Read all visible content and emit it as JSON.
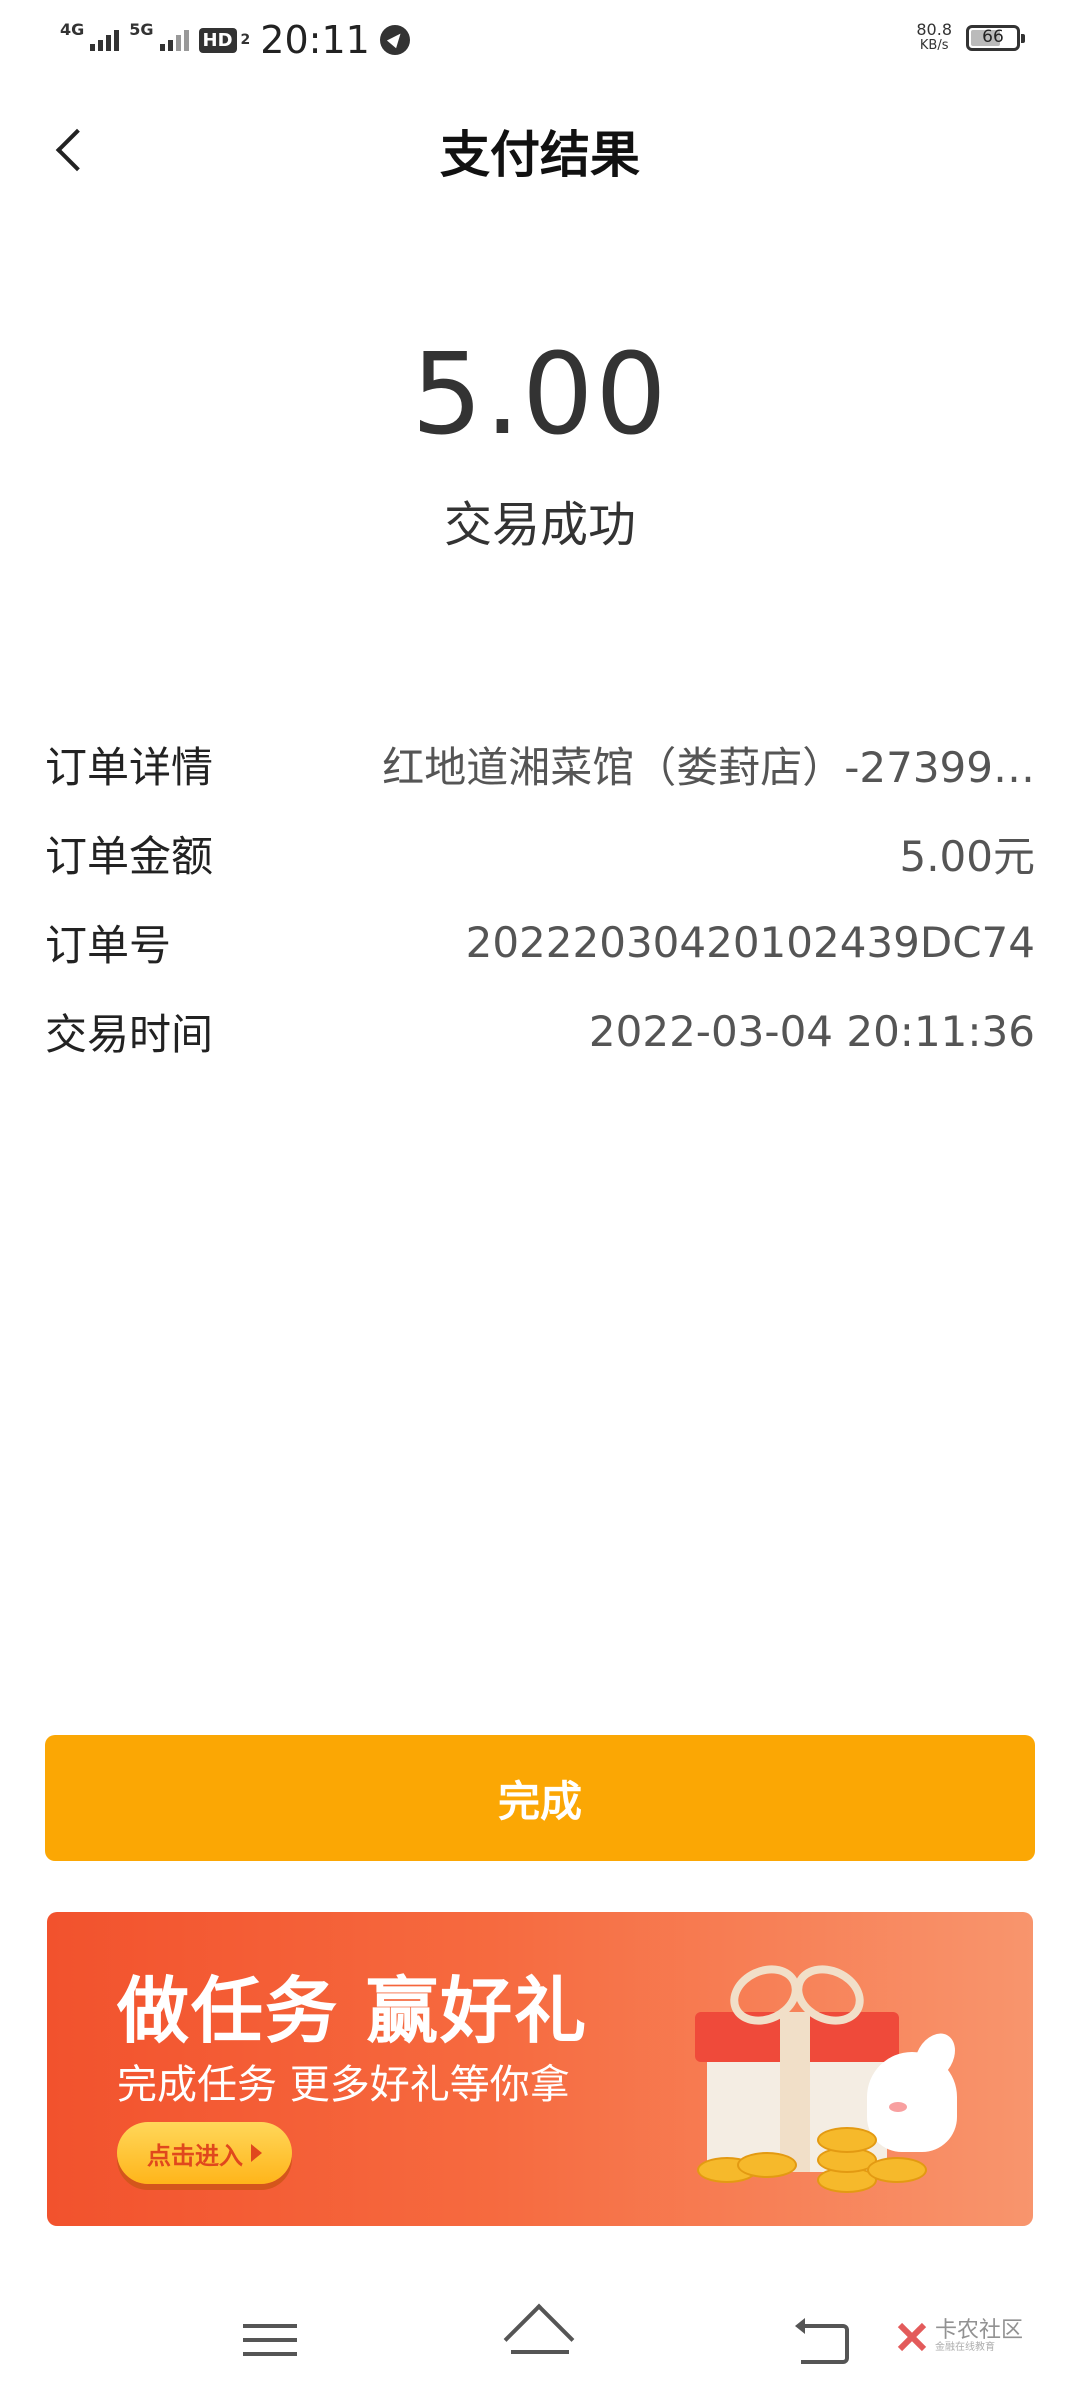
{
  "status_bar": {
    "signal1_label": "4G",
    "signal2_label": "5G",
    "hd_label": "HD",
    "hd_sub": "2",
    "time": "20:11",
    "net_speed_value": "80.8",
    "net_speed_unit": "KB/s",
    "battery_level": "66"
  },
  "header": {
    "back_icon": "chevron-left-icon",
    "title": "支付结果"
  },
  "result": {
    "amount": "5.00",
    "status": "交易成功"
  },
  "details": [
    {
      "label": "订单详情",
      "value": "红地道湘菜馆（娄葑店）-27399…"
    },
    {
      "label": "订单金额",
      "value": "5.00元"
    },
    {
      "label": "订单号",
      "value": "20222030420102439DC74"
    },
    {
      "label": "交易时间",
      "value": "2022-03-04 20:11:36"
    }
  ],
  "done_button": {
    "label": "完成",
    "color": "#fba704"
  },
  "banner": {
    "title": "做任务 赢好礼",
    "subtitle": "完成任务 更多好礼等你拿",
    "button_label": "点击进入"
  },
  "nav_bar": {
    "icons": [
      "menu-icon",
      "home-icon",
      "return-icon"
    ]
  },
  "watermark": {
    "title": "卡农社区",
    "subtitle": "金融在线教育"
  }
}
